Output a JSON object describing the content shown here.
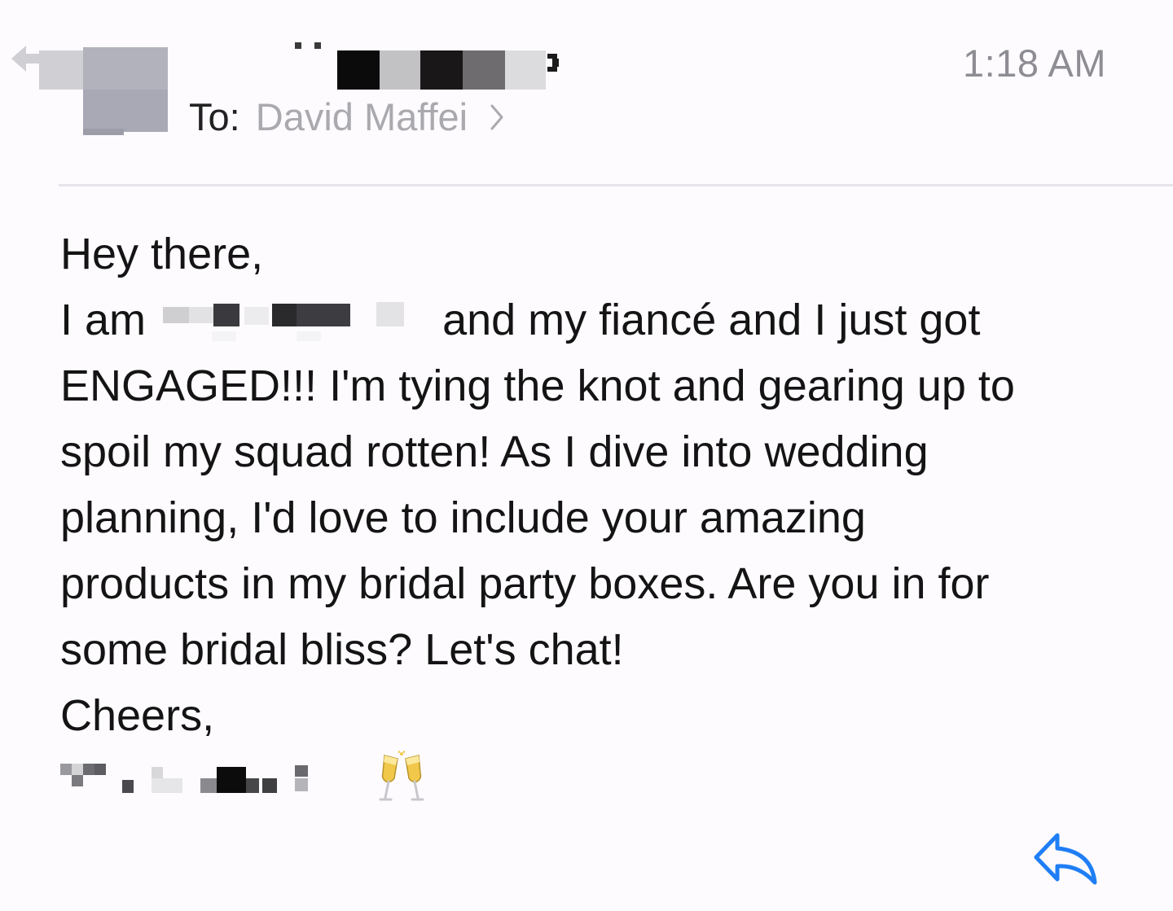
{
  "header": {
    "time": "1:18 AM",
    "to_label": "To:",
    "to_name": "David Maffei",
    "chevron_icon": "chevron-right-icon",
    "back_icon": "back-arrow-icon"
  },
  "message": {
    "greeting": "Hey there,",
    "line1_start": "I am",
    "line1_end": "and my fiancé and I just got",
    "line2": "ENGAGED!!! I'm tying the knot and gearing up to",
    "line3": "spoil my squad rotten! As I dive into wedding",
    "line4": "planning, I'd love to include your amazing",
    "line5": "products in my bridal party boxes. Are you in for",
    "line6": "some bridal bliss? Let's chat!",
    "signoff": "Cheers,"
  },
  "signature": {
    "emoji_icon": "clinking-glasses-icon"
  },
  "footer": {
    "reply_icon": "reply-arrow-icon"
  },
  "colors": {
    "background": "#fdfbfe",
    "time_gray": "#8d8d93",
    "recipient_gray": "#a9a9ae",
    "reply_blue": "#1f7ef5"
  }
}
